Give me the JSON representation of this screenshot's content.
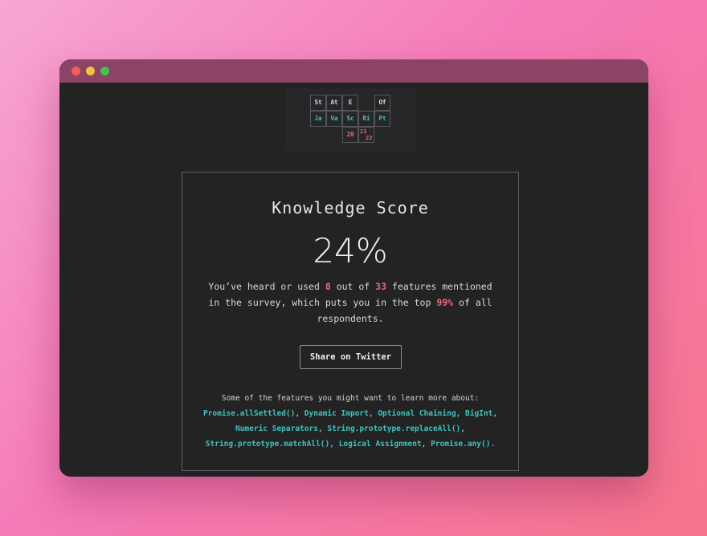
{
  "window": {
    "controls": [
      "close",
      "minimize",
      "zoom"
    ]
  },
  "logo": {
    "row1": [
      "St",
      "At",
      "E",
      "Of"
    ],
    "row2": [
      "Ja",
      "Va",
      "Sc",
      "Ri",
      "Pt"
    ],
    "row3": [
      "20",
      "21",
      "22"
    ]
  },
  "card": {
    "title": "Knowledge Score",
    "score": "24%",
    "desc_part1": "You’ve heard or used ",
    "heard": "8",
    "desc_part2": " out of ",
    "total": "33",
    "desc_part3": " features mentioned in the survey, which puts you in the top ",
    "top": "99%",
    "desc_part4": " of all respondents.",
    "share_label": "Share on Twitter",
    "learn_intro": "Some of the features you might want to learn more about:",
    "features": [
      "Promise.allSettled()",
      "Dynamic Import",
      "Optional Chaining",
      "BigInt",
      "Numeric Separators",
      "String.prototype.replaceAll()",
      "String.prototype.matchAll()",
      "Logical Assignment",
      "Promise.any()"
    ],
    "sep": ", ",
    "end": "."
  },
  "colors": {
    "accent_teal": "#3fc3c0",
    "accent_red": "#f06878",
    "background": "#222322",
    "titlebar": "#8c4466"
  }
}
